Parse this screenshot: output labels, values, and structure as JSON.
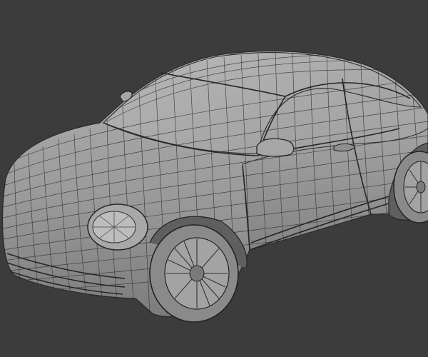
{
  "viewport": {
    "background": "#3c3c3c",
    "shading": "#9a9a9a",
    "shading_dark": "#6f6f6f",
    "shading_light": "#b4b4b4",
    "wire_color": "#2a2a2a"
  }
}
